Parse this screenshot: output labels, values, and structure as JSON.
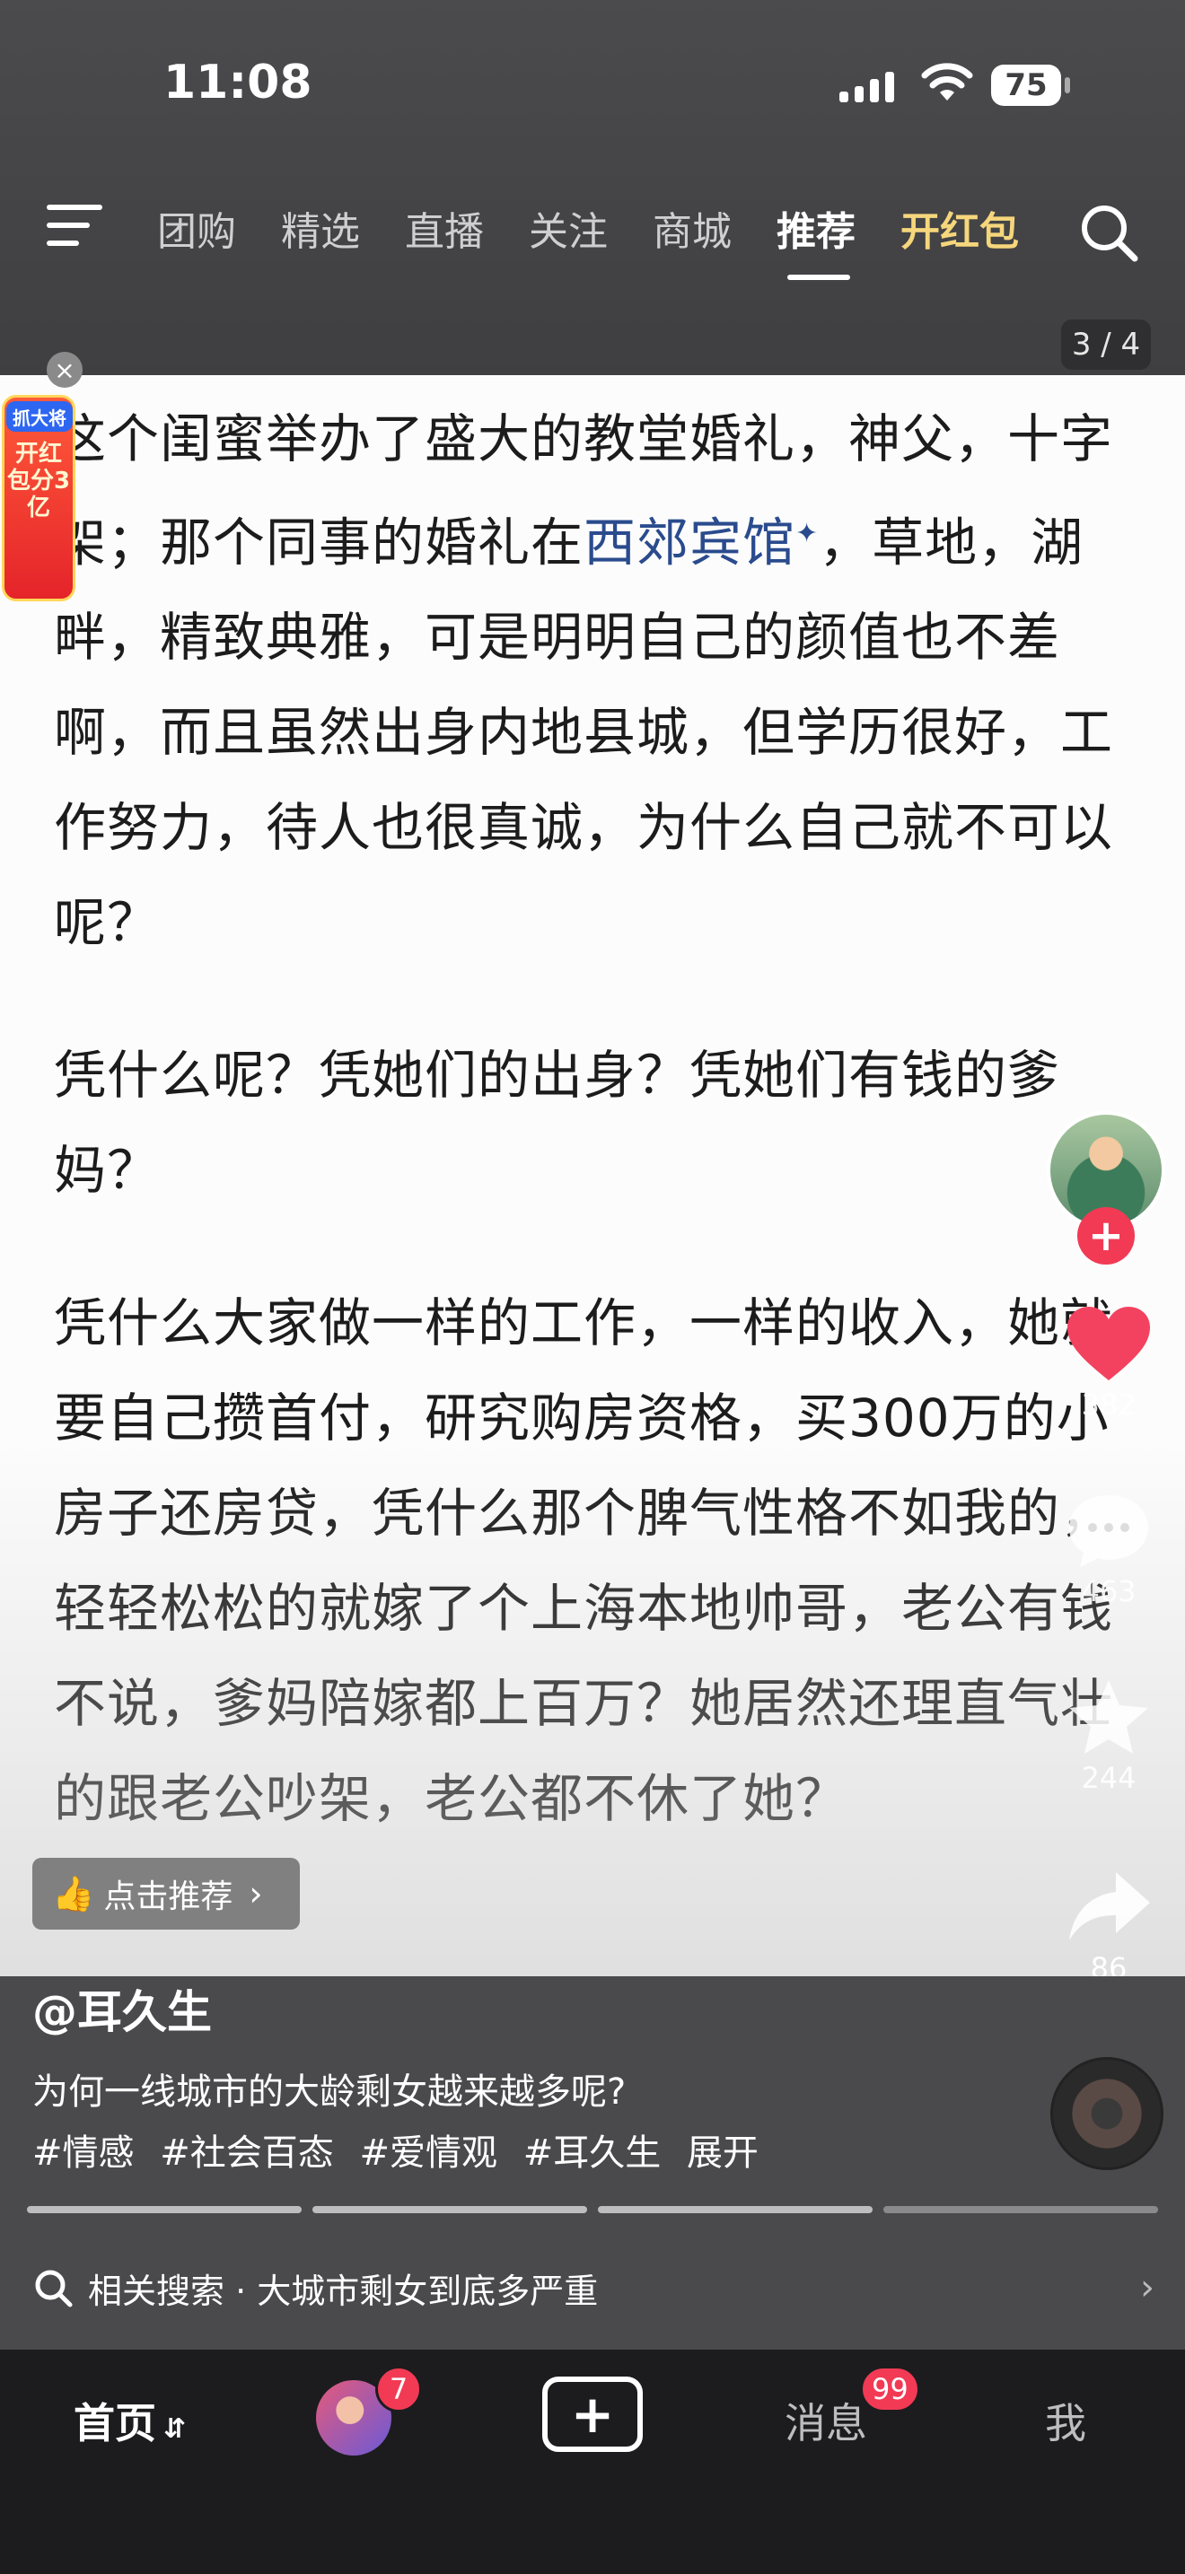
{
  "status": {
    "time": "11:08",
    "battery": "75"
  },
  "nav": {
    "tabs": [
      "团购",
      "精选",
      "直播",
      "关注",
      "商城",
      "推荐",
      "开红包"
    ],
    "active_tab": "推荐"
  },
  "page_counter": "3 / 4",
  "hongbao_badge": {
    "brand": "抓大将",
    "text": "开红包分3亿"
  },
  "article": {
    "p1_before": "这个闺蜜举办了盛大的教堂婚礼，神父，十字架；那个同事的婚礼在",
    "p1_link": "西郊宾馆",
    "p1_after": "，草地，湖畔，精致典雅，可是明明自己的颜值也不差啊，而且虽然出身内地县城，但学历很好，工作努力，待人也很真诚，为什么自己就不可以呢？",
    "p2": "凭什么呢？凭她们的出身？凭她们有钱的爹妈？",
    "p3": "凭什么大家做一样的工作，一样的收入，她就要自己攒首付，研究购房资格，买300万的小房子还房贷，凭什么那个脾气性格不如我的，轻轻松松的就嫁了个上海本地帅哥，老公有钱不说，爹妈陪嫁都上百万？她居然还理直气壮的跟老公吵架，老公都不休了她？"
  },
  "recommend_chip": "点击推荐",
  "actions": {
    "likes": "382",
    "comments": "463",
    "favorites": "244",
    "shares": "86"
  },
  "info": {
    "author": "@耳久生",
    "description": "为何一线城市的大龄剩女越来越多呢?",
    "tags": [
      "#情感",
      "#社会百态",
      "#爱情观",
      "#耳久生"
    ],
    "expand": "展开",
    "progress_total": 4,
    "progress_current": 3
  },
  "related": {
    "label": "相关搜索",
    "separator": "·",
    "query": "大城市剩女到底多严重"
  },
  "tabbar": {
    "home": "首页",
    "friend_badge": "7",
    "messages": "消息",
    "messages_badge": "99",
    "me": "我"
  },
  "colors": {
    "accent_red": "#f23a55",
    "hongbao_gold": "#f6d67c",
    "link_blue": "#2a4b8d"
  }
}
